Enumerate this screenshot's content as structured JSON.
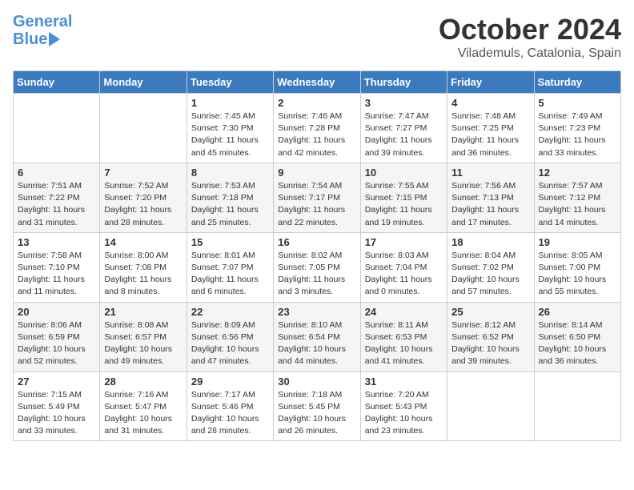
{
  "logo": {
    "line1": "General",
    "line2": "Blue"
  },
  "header": {
    "month": "October 2024",
    "location": "Vilademuls, Catalonia, Spain"
  },
  "days_of_week": [
    "Sunday",
    "Monday",
    "Tuesday",
    "Wednesday",
    "Thursday",
    "Friday",
    "Saturday"
  ],
  "weeks": [
    [
      {
        "day": "",
        "info": ""
      },
      {
        "day": "",
        "info": ""
      },
      {
        "day": "1",
        "info": "Sunrise: 7:45 AM\nSunset: 7:30 PM\nDaylight: 11 hours and 45 minutes."
      },
      {
        "day": "2",
        "info": "Sunrise: 7:46 AM\nSunset: 7:28 PM\nDaylight: 11 hours and 42 minutes."
      },
      {
        "day": "3",
        "info": "Sunrise: 7:47 AM\nSunset: 7:27 PM\nDaylight: 11 hours and 39 minutes."
      },
      {
        "day": "4",
        "info": "Sunrise: 7:48 AM\nSunset: 7:25 PM\nDaylight: 11 hours and 36 minutes."
      },
      {
        "day": "5",
        "info": "Sunrise: 7:49 AM\nSunset: 7:23 PM\nDaylight: 11 hours and 33 minutes."
      }
    ],
    [
      {
        "day": "6",
        "info": "Sunrise: 7:51 AM\nSunset: 7:22 PM\nDaylight: 11 hours and 31 minutes."
      },
      {
        "day": "7",
        "info": "Sunrise: 7:52 AM\nSunset: 7:20 PM\nDaylight: 11 hours and 28 minutes."
      },
      {
        "day": "8",
        "info": "Sunrise: 7:53 AM\nSunset: 7:18 PM\nDaylight: 11 hours and 25 minutes."
      },
      {
        "day": "9",
        "info": "Sunrise: 7:54 AM\nSunset: 7:17 PM\nDaylight: 11 hours and 22 minutes."
      },
      {
        "day": "10",
        "info": "Sunrise: 7:55 AM\nSunset: 7:15 PM\nDaylight: 11 hours and 19 minutes."
      },
      {
        "day": "11",
        "info": "Sunrise: 7:56 AM\nSunset: 7:13 PM\nDaylight: 11 hours and 17 minutes."
      },
      {
        "day": "12",
        "info": "Sunrise: 7:57 AM\nSunset: 7:12 PM\nDaylight: 11 hours and 14 minutes."
      }
    ],
    [
      {
        "day": "13",
        "info": "Sunrise: 7:58 AM\nSunset: 7:10 PM\nDaylight: 11 hours and 11 minutes."
      },
      {
        "day": "14",
        "info": "Sunrise: 8:00 AM\nSunset: 7:08 PM\nDaylight: 11 hours and 8 minutes."
      },
      {
        "day": "15",
        "info": "Sunrise: 8:01 AM\nSunset: 7:07 PM\nDaylight: 11 hours and 6 minutes."
      },
      {
        "day": "16",
        "info": "Sunrise: 8:02 AM\nSunset: 7:05 PM\nDaylight: 11 hours and 3 minutes."
      },
      {
        "day": "17",
        "info": "Sunrise: 8:03 AM\nSunset: 7:04 PM\nDaylight: 11 hours and 0 minutes."
      },
      {
        "day": "18",
        "info": "Sunrise: 8:04 AM\nSunset: 7:02 PM\nDaylight: 10 hours and 57 minutes."
      },
      {
        "day": "19",
        "info": "Sunrise: 8:05 AM\nSunset: 7:00 PM\nDaylight: 10 hours and 55 minutes."
      }
    ],
    [
      {
        "day": "20",
        "info": "Sunrise: 8:06 AM\nSunset: 6:59 PM\nDaylight: 10 hours and 52 minutes."
      },
      {
        "day": "21",
        "info": "Sunrise: 8:08 AM\nSunset: 6:57 PM\nDaylight: 10 hours and 49 minutes."
      },
      {
        "day": "22",
        "info": "Sunrise: 8:09 AM\nSunset: 6:56 PM\nDaylight: 10 hours and 47 minutes."
      },
      {
        "day": "23",
        "info": "Sunrise: 8:10 AM\nSunset: 6:54 PM\nDaylight: 10 hours and 44 minutes."
      },
      {
        "day": "24",
        "info": "Sunrise: 8:11 AM\nSunset: 6:53 PM\nDaylight: 10 hours and 41 minutes."
      },
      {
        "day": "25",
        "info": "Sunrise: 8:12 AM\nSunset: 6:52 PM\nDaylight: 10 hours and 39 minutes."
      },
      {
        "day": "26",
        "info": "Sunrise: 8:14 AM\nSunset: 6:50 PM\nDaylight: 10 hours and 36 minutes."
      }
    ],
    [
      {
        "day": "27",
        "info": "Sunrise: 7:15 AM\nSunset: 5:49 PM\nDaylight: 10 hours and 33 minutes."
      },
      {
        "day": "28",
        "info": "Sunrise: 7:16 AM\nSunset: 5:47 PM\nDaylight: 10 hours and 31 minutes."
      },
      {
        "day": "29",
        "info": "Sunrise: 7:17 AM\nSunset: 5:46 PM\nDaylight: 10 hours and 28 minutes."
      },
      {
        "day": "30",
        "info": "Sunrise: 7:18 AM\nSunset: 5:45 PM\nDaylight: 10 hours and 26 minutes."
      },
      {
        "day": "31",
        "info": "Sunrise: 7:20 AM\nSunset: 5:43 PM\nDaylight: 10 hours and 23 minutes."
      },
      {
        "day": "",
        "info": ""
      },
      {
        "day": "",
        "info": ""
      }
    ]
  ]
}
